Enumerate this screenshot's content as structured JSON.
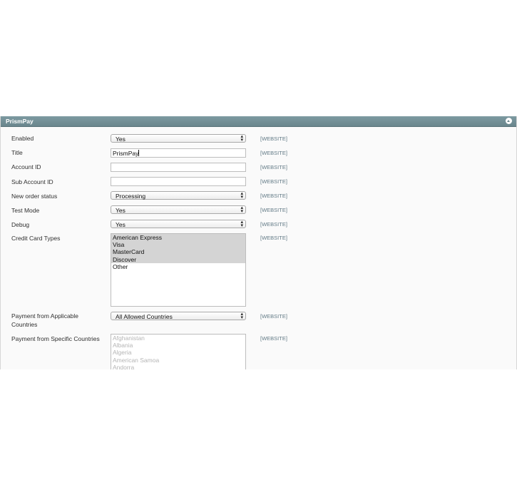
{
  "panel": {
    "title": "PrismPay"
  },
  "scope_label": "[WEBSITE]",
  "fields": {
    "enabled": {
      "label": "Enabled",
      "value": "Yes"
    },
    "title": {
      "label": "Title",
      "value": "PrismPay"
    },
    "account_id": {
      "label": "Account ID",
      "value": ""
    },
    "sub_account_id": {
      "label": "Sub Account ID",
      "value": ""
    },
    "new_order_status": {
      "label": "New order status",
      "value": "Processing"
    },
    "test_mode": {
      "label": "Test Mode",
      "value": "Yes"
    },
    "debug": {
      "label": "Debug",
      "value": "Yes"
    },
    "credit_card_types": {
      "label": "Credit Card Types",
      "options": [
        {
          "label": "American Express",
          "selected": true
        },
        {
          "label": "Visa",
          "selected": true
        },
        {
          "label": "MasterCard",
          "selected": true
        },
        {
          "label": "Discover",
          "selected": true
        },
        {
          "label": "Other",
          "selected": false
        }
      ]
    },
    "applicable_countries": {
      "label_line1": "Payment from Applicable",
      "label_line2": "Countries",
      "value": "All Allowed Countries"
    },
    "specific_countries": {
      "label": "Payment from Specific Countries",
      "options": [
        "Afghanistan",
        "Albania",
        "Algeria",
        "American Samoa",
        "Andorra"
      ]
    }
  }
}
